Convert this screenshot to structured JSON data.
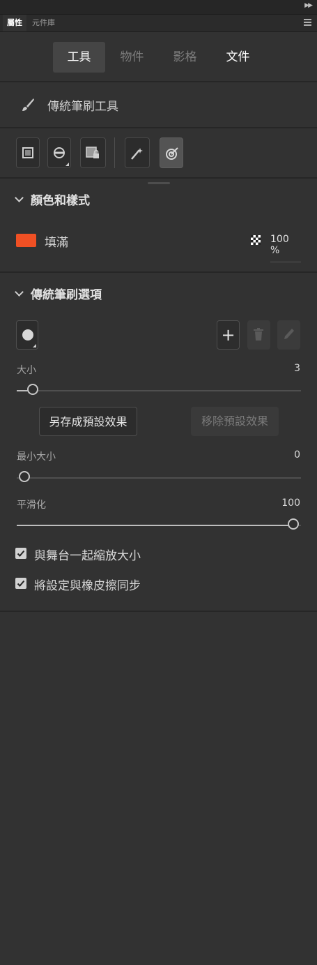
{
  "panel": {
    "tabs": [
      {
        "label": "屬性"
      },
      {
        "label": "元件庫"
      }
    ],
    "segments": [
      {
        "label": "工具"
      },
      {
        "label": "物件"
      },
      {
        "label": "影格"
      },
      {
        "label": "文件"
      }
    ],
    "selected_segment": "工具"
  },
  "tool": {
    "name": "傳統筆刷工具",
    "icon": "brush-icon"
  },
  "tool_buttons": [
    {
      "icon": "object-drawing-icon"
    },
    {
      "icon": "brush-mode-icon"
    },
    {
      "icon": "lock-fill-icon"
    },
    {
      "icon": "pressure-icon"
    },
    {
      "icon": "tilt-icon",
      "selected": true
    }
  ],
  "color_section": {
    "title": "顏色和樣式",
    "fill_label": "填滿",
    "fill_color": "#f05024",
    "opacity": "100 %"
  },
  "brush_section": {
    "title": "傳統筆刷選項",
    "size": {
      "label": "大小",
      "value": "3",
      "fraction": 0.03
    },
    "save_preset": "另存成預設效果",
    "remove_preset": "移除預設效果",
    "min_size": {
      "label": "最小大小",
      "value": "0",
      "fraction": 0.0
    },
    "smoothing": {
      "label": "平滑化",
      "value": "100",
      "fraction": 1.0
    },
    "checkboxes": [
      {
        "label": "與舞台一起縮放大小",
        "checked": true
      },
      {
        "label": "將設定與橡皮擦同步",
        "checked": true
      }
    ]
  }
}
